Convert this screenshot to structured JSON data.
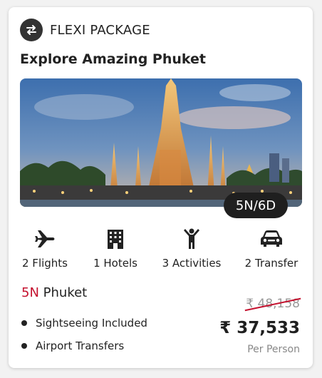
{
  "header": {
    "label": "FLEXI PACKAGE",
    "icon": "swap-arrows-icon"
  },
  "title": "Explore Amazing Phuket",
  "hero": {
    "image": "temple-photo",
    "duration": "5N/6D"
  },
  "amenities": [
    {
      "icon": "airplane-icon",
      "label": "2 Flights"
    },
    {
      "icon": "hotel-building-icon",
      "label": "1 Hotels"
    },
    {
      "icon": "person-activity-icon",
      "label": "3 Activities"
    },
    {
      "icon": "car-icon",
      "label": "2 Transfer"
    }
  ],
  "destination": {
    "nights": "5N",
    "city": "Phuket"
  },
  "inclusions": [
    "Sightseeing Included",
    "Airport Transfers"
  ],
  "pricing": {
    "old_price": "₹ 48,158",
    "price": "₹ 37,533",
    "per": "Per Person"
  },
  "colors": {
    "accent": "#c4122f",
    "dark": "#1f1f1f"
  }
}
